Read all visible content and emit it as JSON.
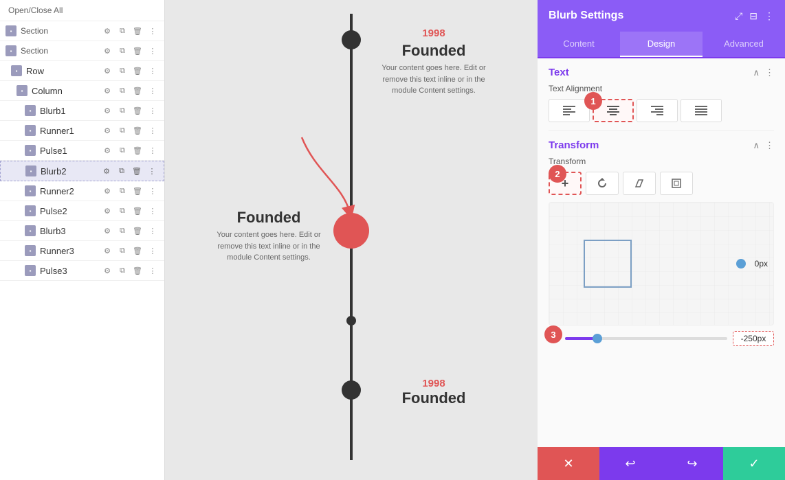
{
  "left_panel": {
    "open_close_all": "Open/Close All",
    "items": [
      {
        "id": "section1",
        "label": "Section",
        "indent": "section",
        "active": false
      },
      {
        "id": "section2",
        "label": "Section",
        "indent": "section",
        "active": false
      },
      {
        "id": "row1",
        "label": "Row",
        "indent": "row",
        "active": false
      },
      {
        "id": "column1",
        "label": "Column",
        "indent": "column",
        "active": false
      },
      {
        "id": "blurb1",
        "label": "Blurb1",
        "indent": "module",
        "active": false
      },
      {
        "id": "runner1",
        "label": "Runner1",
        "indent": "module",
        "active": false
      },
      {
        "id": "pulse1",
        "label": "Pulse1",
        "indent": "module",
        "active": false
      },
      {
        "id": "blurb2",
        "label": "Blurb2",
        "indent": "module",
        "active": true
      },
      {
        "id": "runner2",
        "label": "Runner2",
        "indent": "module",
        "active": false
      },
      {
        "id": "pulse2",
        "label": "Pulse2",
        "indent": "module",
        "active": false
      },
      {
        "id": "blurb3",
        "label": "Blurb3",
        "indent": "module",
        "active": false
      },
      {
        "id": "runner3",
        "label": "Runner3",
        "indent": "module",
        "active": false
      },
      {
        "id": "pulse3",
        "label": "Pulse3",
        "indent": "module",
        "active": false
      }
    ]
  },
  "canvas": {
    "timeline_items": [
      {
        "id": "item1",
        "side": "right",
        "dot_type": "small",
        "year": "1998",
        "year_color": "#e05555",
        "title": "Founded",
        "body": "Your content goes here. Edit or remove this text inline or in the module Content settings."
      },
      {
        "id": "item2",
        "side": "left",
        "dot_type": "large",
        "title": "Founded",
        "body": "Your content goes here. Edit or remove this text inline or in the module Content settings."
      },
      {
        "id": "item3",
        "side": "right",
        "dot_type": "small",
        "year": "1998",
        "year_color": "#e05555",
        "title": "Founded",
        "body": ""
      }
    ]
  },
  "right_panel": {
    "title": "Blurb Settings",
    "tabs": [
      "Content",
      "Design",
      "Advanced"
    ],
    "active_tab": "Design",
    "text_section": {
      "title": "Text",
      "alignment": {
        "label": "Text Alignment",
        "options": [
          "left",
          "center",
          "right",
          "justify"
        ],
        "active": "center",
        "icons": [
          "≡",
          "≡",
          "≡",
          "≡"
        ]
      }
    },
    "transform_section": {
      "title": "Transform",
      "label": "Transform",
      "buttons": [
        "+",
        "↺",
        "◇",
        "⊞"
      ],
      "active_button": "+",
      "slider_value": "-250px",
      "handle_value": "0px"
    },
    "footer": {
      "cancel_icon": "✕",
      "undo_icon": "↩",
      "redo_icon": "↪",
      "confirm_icon": "✓"
    }
  },
  "badges": {
    "badge1_label": "1",
    "badge2_label": "2",
    "badge3_label": "3"
  }
}
